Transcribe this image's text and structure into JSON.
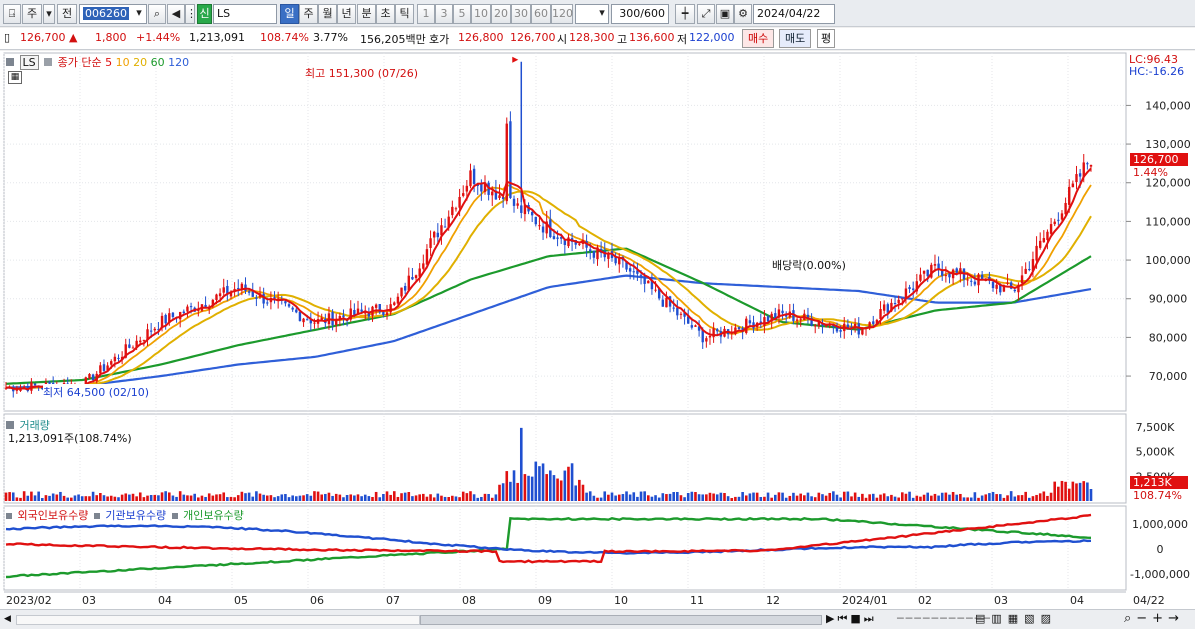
{
  "toolbar": {
    "btn_jang": "주",
    "btn_jeon": "전",
    "code": "006260",
    "badge_sin": "신",
    "name": "LS",
    "periods": [
      "일",
      "주",
      "월",
      "년",
      "분",
      "초",
      "틱"
    ],
    "nums": [
      "1",
      "3",
      "5",
      "10",
      "20",
      "30",
      "60",
      "120"
    ],
    "count": "300",
    "count_total": "/600",
    "date": "2024/04/22"
  },
  "quote": {
    "price": "126,700 ▲",
    "change": "1,800",
    "change_pct": "+1.44%",
    "volume": "1,213,091",
    "vol_ratio": "108.74%",
    "turnover": "3.77%",
    "amount": "156,205백만",
    "hoga_label": "호가",
    "ask": "126,800",
    "bid": "126,700",
    "open_label": "시",
    "open": "128,300",
    "high_label": "고",
    "high": "136,600",
    "low_label": "저",
    "low": "122,000",
    "buy": "매수",
    "sell": "매도",
    "eq": "평"
  },
  "price_panel": {
    "ticker_box": "LS",
    "legend_title": "종가 단순",
    "ma_labels": [
      "5",
      "10",
      "20",
      "60",
      "120"
    ],
    "lc": "LC:96.43",
    "hc": "HC:-16.26",
    "high_annot": "최고 151,300 (07/26)",
    "low_annot": "최저 64,500 (02/10)",
    "div_annot": "배당락(0.00%)",
    "y_ticks": [
      "140,000",
      "130,000",
      "120,000",
      "110,000",
      "100,000",
      "90,000",
      "80,000",
      "70,000"
    ],
    "last_price": "126,700",
    "last_pct": "1.44%"
  },
  "volume_panel": {
    "title": "거래량",
    "value": "1,213,091주(108.74%)",
    "y_ticks": [
      "7,500K",
      "5,000K",
      "2,500K"
    ],
    "last": "1,213K",
    "last_pct": "108.74%"
  },
  "holding_panel": {
    "legend": [
      "외국인보유수량",
      "기관보유수량",
      "개인보유수량"
    ],
    "y_ticks": [
      "1,000,000",
      "0",
      "-1,000,000"
    ]
  },
  "x_axis": {
    "labels": [
      "2023/02",
      "03",
      "04",
      "05",
      "06",
      "07",
      "08",
      "09",
      "10",
      "11",
      "12",
      "2024/01",
      "02",
      "03",
      "04"
    ],
    "right_label": "04/22"
  },
  "colors": {
    "up": "#e01010",
    "down": "#1f4fd0",
    "ma5": "#e01010",
    "ma10": "#f0a000",
    "ma20": "#e0b000",
    "ma60": "#1c9a2c",
    "ma120": "#2f5fd8"
  },
  "chart_data": {
    "type": "line",
    "title": "LS",
    "x_labels": [
      "2023/02",
      "03",
      "04",
      "05",
      "06",
      "07",
      "08",
      "09",
      "10",
      "11",
      "12",
      "2024/01",
      "02",
      "03",
      "04"
    ],
    "close_approx": [
      67000,
      68000,
      84000,
      93000,
      84000,
      88000,
      122000,
      108000,
      98000,
      80000,
      86000,
      82000,
      98000,
      92000,
      126700
    ],
    "ma60_approx": [
      68000,
      69000,
      73000,
      78000,
      82000,
      86000,
      95000,
      101000,
      103000,
      94000,
      84000,
      82000,
      87000,
      89000,
      101000
    ],
    "ma120_approx": [
      67000,
      67500,
      70000,
      73000,
      75000,
      79000,
      86000,
      93000,
      96000,
      94000,
      93000,
      92000,
      89000,
      89000,
      92500
    ],
    "ylim": [
      62000,
      152000
    ]
  }
}
